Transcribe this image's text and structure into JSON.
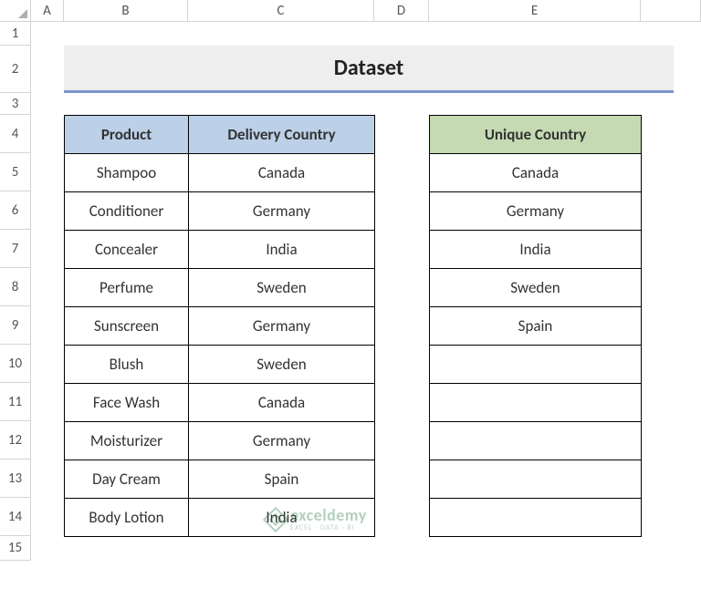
{
  "columns": [
    "A",
    "B",
    "C",
    "D",
    "E"
  ],
  "row_numbers": [
    "1",
    "2",
    "3",
    "4",
    "5",
    "6",
    "7",
    "8",
    "9",
    "10",
    "11",
    "12",
    "13",
    "14",
    "15"
  ],
  "title": "Dataset",
  "table1": {
    "headers": {
      "product": "Product",
      "delivery": "Delivery Country"
    },
    "rows": [
      {
        "product": "Shampoo",
        "delivery": "Canada"
      },
      {
        "product": "Conditioner",
        "delivery": "Germany"
      },
      {
        "product": "Concealer",
        "delivery": "India"
      },
      {
        "product": "Perfume",
        "delivery": "Sweden"
      },
      {
        "product": "Sunscreen",
        "delivery": "Germany"
      },
      {
        "product": "Blush",
        "delivery": "Sweden"
      },
      {
        "product": "Face Wash",
        "delivery": "Canada"
      },
      {
        "product": "Moisturizer",
        "delivery": "Germany"
      },
      {
        "product": "Day Cream",
        "delivery": "Spain"
      },
      {
        "product": "Body Lotion",
        "delivery": "India"
      }
    ]
  },
  "table2": {
    "header": "Unique Country",
    "rows": [
      "Canada",
      "Germany",
      "India",
      "Sweden",
      "Spain",
      "",
      "",
      "",
      "",
      ""
    ]
  },
  "watermark": {
    "brand": "exceldemy",
    "tagline": "EXCEL · DATA · BI"
  }
}
